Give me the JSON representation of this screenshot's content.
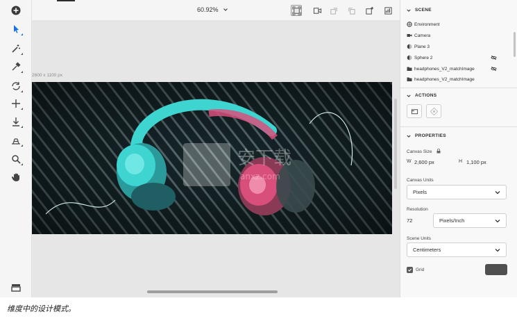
{
  "toolbar": {
    "tools": [
      {
        "icon": "add-circle-icon",
        "label": ""
      },
      {
        "icon": "select-arrow-icon"
      },
      {
        "icon": "magic-wand-icon"
      },
      {
        "icon": "eyedropper-icon"
      },
      {
        "icon": "orbit-icon"
      },
      {
        "icon": "move-icon"
      },
      {
        "icon": "drop-to-ground-icon"
      },
      {
        "icon": "grid-placement-icon"
      },
      {
        "icon": "zoom-icon"
      },
      {
        "icon": "pan-hand-icon"
      },
      {
        "icon": "layers-panel-icon"
      }
    ],
    "active_color": "#1473e6"
  },
  "topbar": {
    "zoom_value": "60.92%",
    "icons": [
      "frame-icon",
      "camera-bookmark-icon",
      "undo-view-icon",
      "redo-view-icon",
      "light-icon",
      "render-icon"
    ]
  },
  "canvas": {
    "dimensions_label": "2600 x 1100 px",
    "background_color": "#e6e6e6",
    "artboard_accent": "#3ed4d0",
    "artboard_pink": "#d94f7c"
  },
  "panel": {
    "scene": {
      "title": "SCENE",
      "items": [
        {
          "label": "Environment",
          "icon": "environment-icon",
          "hidden": false
        },
        {
          "label": "Camera",
          "icon": "camera-icon",
          "hidden": false
        },
        {
          "label": "Plane 3",
          "icon": "material-sphere-icon",
          "hidden": false
        },
        {
          "label": "Sphere 2",
          "icon": "material-sphere-icon",
          "hidden": true
        },
        {
          "label": "headphones_V2_matchImage",
          "icon": "folder-icon",
          "hidden": true
        },
        {
          "label": "headphones_V2_matchImage",
          "icon": "folder-icon",
          "hidden": false
        }
      ]
    },
    "actions": {
      "title": "ACTIONS",
      "buttons": [
        "canvas-size-icon",
        "match-image-icon"
      ]
    },
    "properties": {
      "title": "PROPERTIES",
      "canvas_size_label": "Canvas Size",
      "width_label": "W",
      "width_value": "2,600 px",
      "height_label": "H",
      "height_value": "1,100 px",
      "canvas_units_label": "Canvas Units",
      "canvas_units_value": "Pixels",
      "resolution_label": "Resolution",
      "resolution_value": "72",
      "resolution_units": "Pixels/Inch",
      "scene_units_label": "Scene Units",
      "scene_units_value": "Centimeters",
      "grid_label": "Grid",
      "grid_checked": true,
      "grid_color": "#505050"
    }
  },
  "caption": "维度中的设计模式。"
}
